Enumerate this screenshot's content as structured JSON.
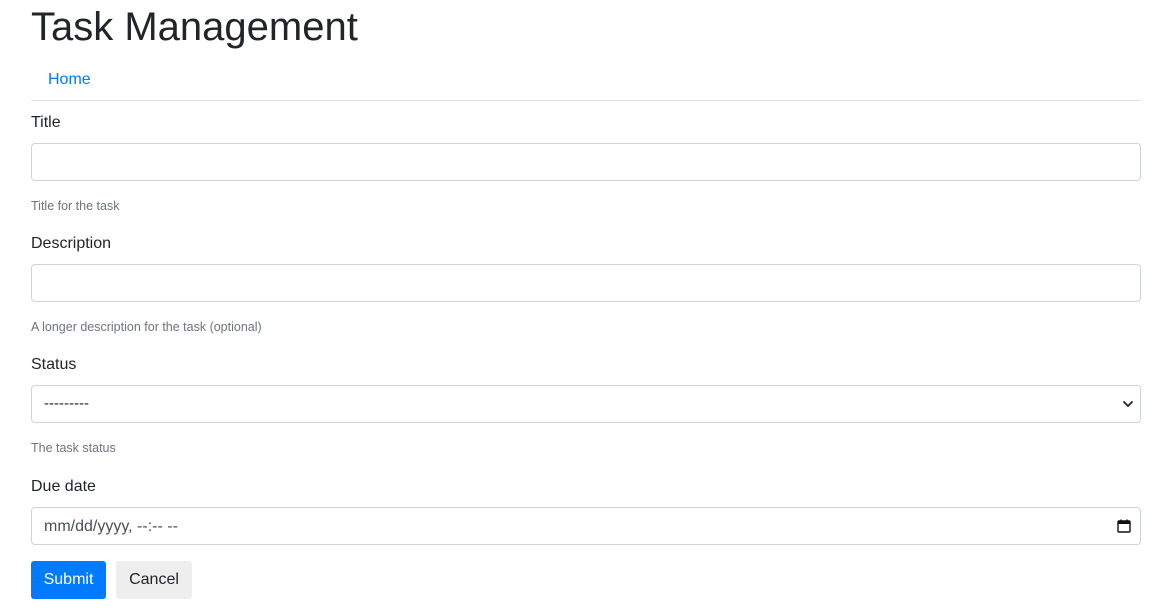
{
  "header": {
    "title": "Task Management"
  },
  "nav": {
    "items": [
      {
        "label": "Home"
      }
    ]
  },
  "form": {
    "title": {
      "label": "Title",
      "value": "",
      "help": "Title for the task"
    },
    "description": {
      "label": "Description",
      "value": "",
      "help": "A longer description for the task (optional)"
    },
    "status": {
      "label": "Status",
      "selected": "---------",
      "help": "The task status"
    },
    "due_date": {
      "label": "Due date",
      "placeholder": "mm/dd/yyyy, --:-- --"
    },
    "actions": {
      "submit_label": "Submit",
      "cancel_label": "Cancel"
    }
  },
  "colors": {
    "primary": "#007bff",
    "secondary_button": "#eeeeee",
    "border": "#ced4da",
    "muted_text": "#6c757d"
  },
  "icons": {
    "select": "chevron-down-icon",
    "date": "calendar-icon"
  }
}
